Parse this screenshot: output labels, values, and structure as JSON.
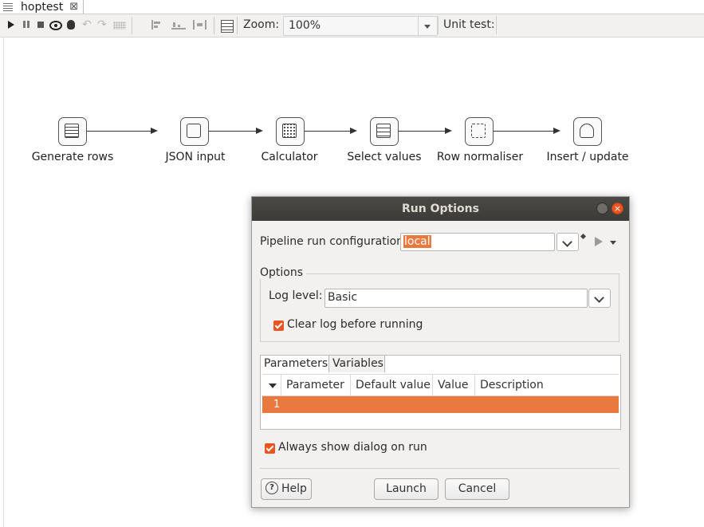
{
  "tab": {
    "title": "hoptest",
    "close_glyph": "⊠"
  },
  "toolbar": {
    "zoom_label": "Zoom:",
    "zoom_value": "100%",
    "unit_test_label": "Unit test:",
    "icons": [
      "run-icon",
      "pause-icon",
      "stop-icon",
      "preview-icon",
      "debug-icon",
      "undo-icon",
      "redo-icon",
      "snap-grid-icon",
      "align-left-icon",
      "align-bottom-icon",
      "distribute-icon",
      "show-grid-icon"
    ]
  },
  "pipeline": {
    "steps": [
      {
        "label": "Generate rows",
        "icon": "generate-rows-icon"
      },
      {
        "label": "JSON input",
        "icon": "json-input-icon"
      },
      {
        "label": "Calculator",
        "icon": "calculator-icon"
      },
      {
        "label": "Select values",
        "icon": "select-values-icon"
      },
      {
        "label": "Row normaliser",
        "icon": "row-normaliser-icon"
      },
      {
        "label": "Insert / update",
        "icon": "insert-update-icon"
      }
    ]
  },
  "dialog": {
    "title": "Run Options",
    "run_config_label": "Pipeline run configuration",
    "run_config_value": "local",
    "options_legend": "Options",
    "log_level_label": "Log level:",
    "log_level_value": "Basic",
    "clear_log_label": "Clear log before running",
    "clear_log_checked": true,
    "tabs": [
      "Parameters",
      "Variables"
    ],
    "columns": [
      "Parameter",
      "Default value",
      "Value",
      "Description"
    ],
    "rows": [
      {
        "index": "1"
      }
    ],
    "always_show_label": "Always show dialog on run",
    "always_show_checked": true,
    "help_label": "Help",
    "launch_label": "Launch",
    "cancel_label": "Cancel",
    "accent_color": "#e9793f"
  }
}
